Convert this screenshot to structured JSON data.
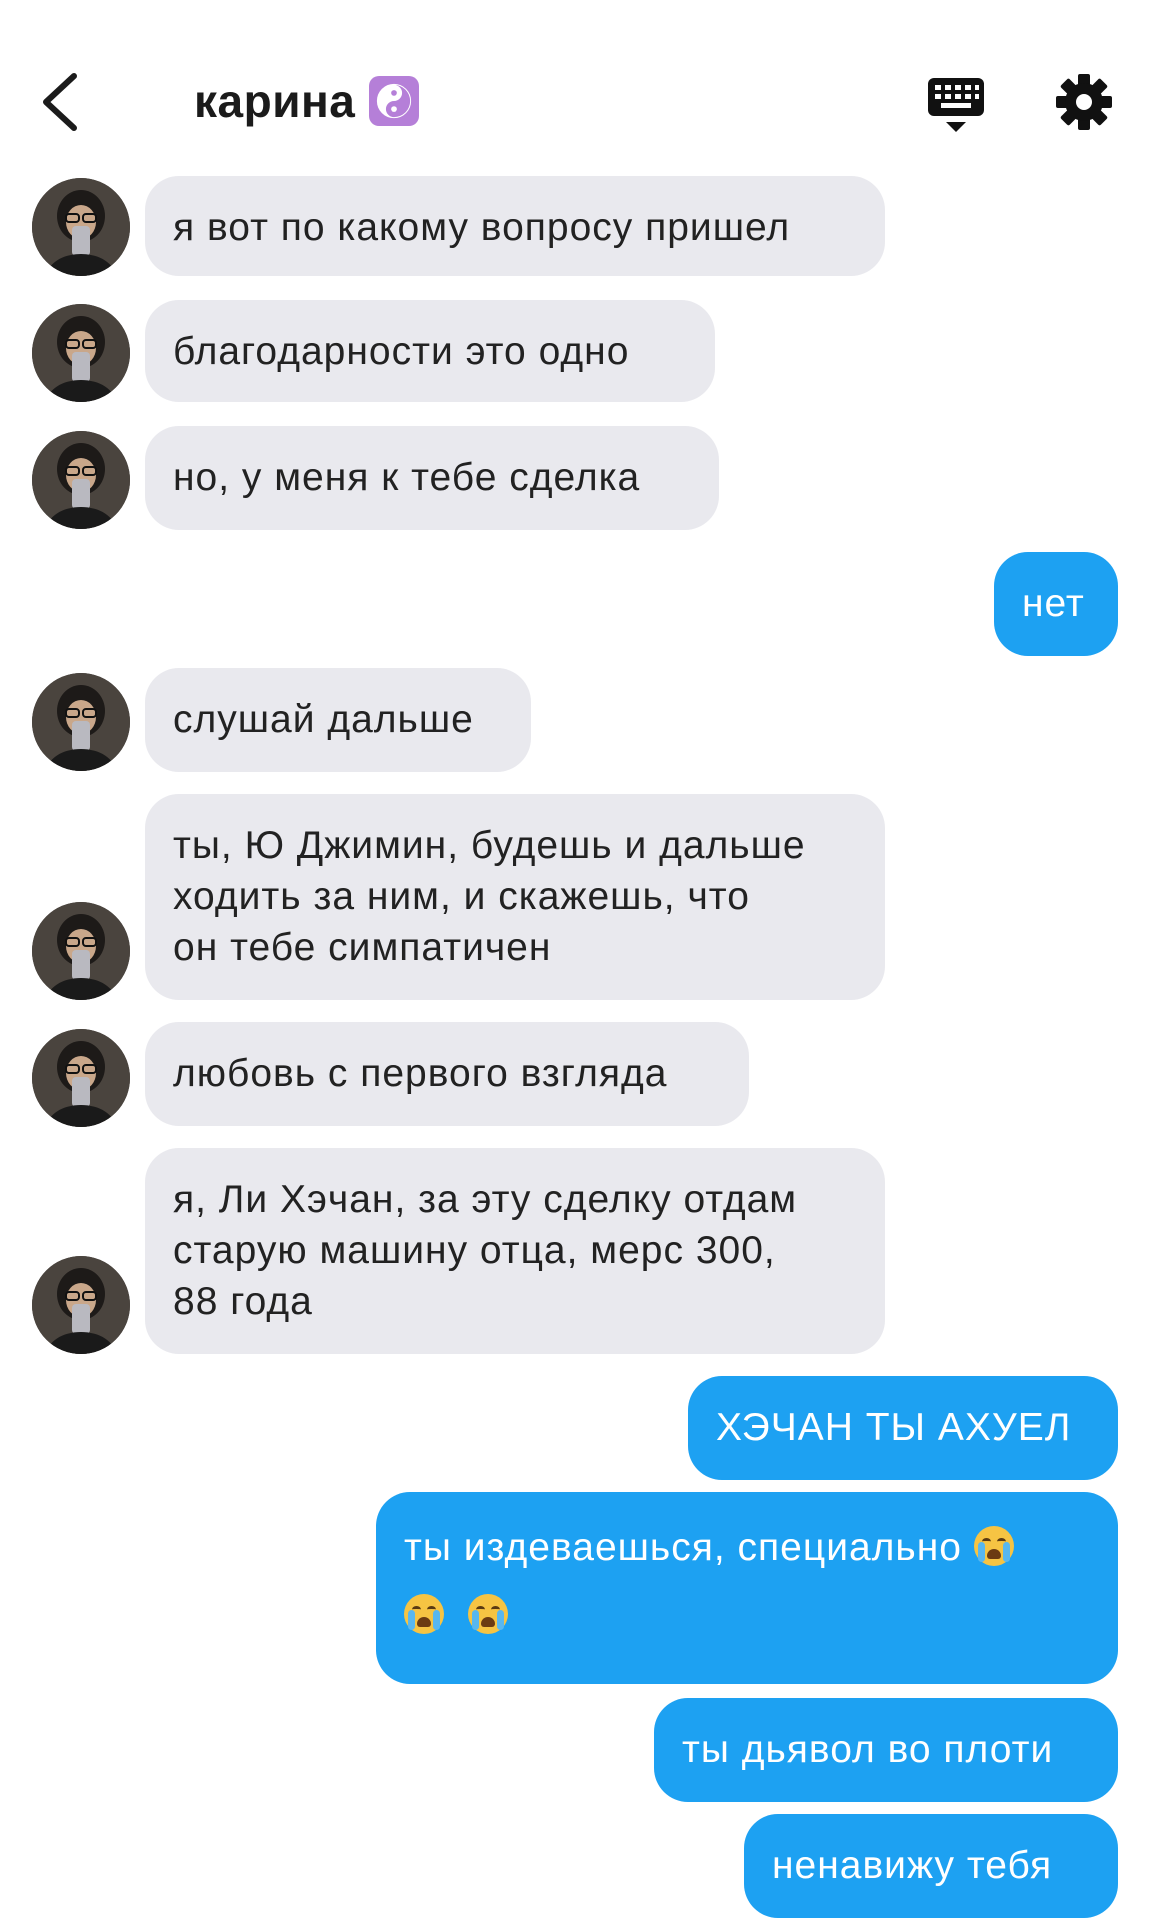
{
  "header": {
    "title": "карина",
    "title_emoji": "yin-yang-icon",
    "back_icon": "chevron-left-icon",
    "keyboard_icon": "keyboard-icon",
    "settings_icon": "gear-icon"
  },
  "colors": {
    "incoming_bubble": "#e9e9ee",
    "outgoing_bubble": "#1da1f2",
    "title_emoji_bg": "#b57fd8"
  },
  "messages": [
    {
      "side": "incoming",
      "text": "я вот по какому вопросу пришел"
    },
    {
      "side": "incoming",
      "text": "благодарности это одно"
    },
    {
      "side": "incoming",
      "text": "но, у меня к тебе сделка"
    },
    {
      "side": "outgoing",
      "text": "нет"
    },
    {
      "side": "incoming",
      "text": "слушай дальше"
    },
    {
      "side": "incoming",
      "lines": [
        "ты, Ю Джимин, будешь и дальше",
        "ходить за ним, и скажешь, что",
        "он тебе симпатичен"
      ]
    },
    {
      "side": "incoming",
      "text": "любовь с первого взгляда"
    },
    {
      "side": "incoming",
      "lines": [
        "я, Ли Хэчан, за эту сделку отдам",
        "старую машину отца, мерс 300,",
        "88 года"
      ]
    },
    {
      "side": "outgoing",
      "text": "ХЭЧАН ТЫ АХУЕЛ"
    },
    {
      "side": "outgoing",
      "text": "ты издеваешься, специально",
      "emoji": "loudly-crying-face-icon"
    },
    {
      "side": "outgoing",
      "text": "ты дьявол во плоти"
    },
    {
      "side": "outgoing",
      "text": "ненавижу тебя"
    }
  ]
}
